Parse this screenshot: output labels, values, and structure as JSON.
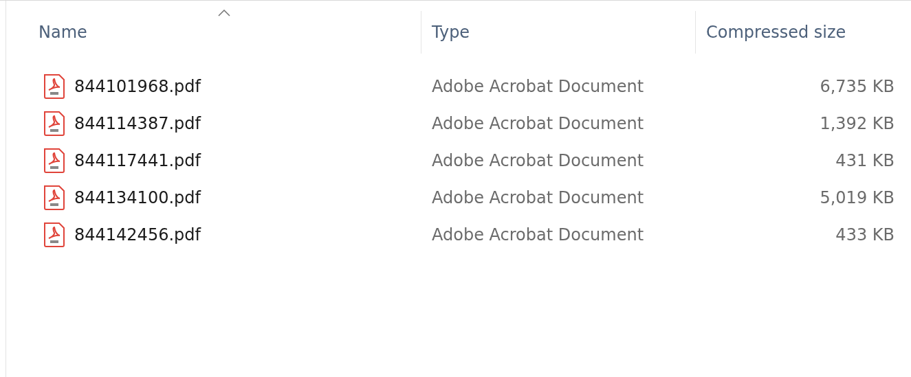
{
  "columns": [
    {
      "label": "Name",
      "sorted": true
    },
    {
      "label": "Type",
      "sorted": false
    },
    {
      "label": "Compressed size",
      "sorted": false
    }
  ],
  "rows": [
    {
      "name": "844101968.pdf",
      "type": "Adobe Acrobat Document",
      "size": "6,735 KB"
    },
    {
      "name": "844114387.pdf",
      "type": "Adobe Acrobat Document",
      "size": "1,392 KB"
    },
    {
      "name": "844117441.pdf",
      "type": "Adobe Acrobat Document",
      "size": "431 KB"
    },
    {
      "name": "844134100.pdf",
      "type": "Adobe Acrobat Document",
      "size": "5,019 KB"
    },
    {
      "name": "844142456.pdf",
      "type": "Adobe Acrobat Document",
      "size": "433 KB"
    }
  ]
}
